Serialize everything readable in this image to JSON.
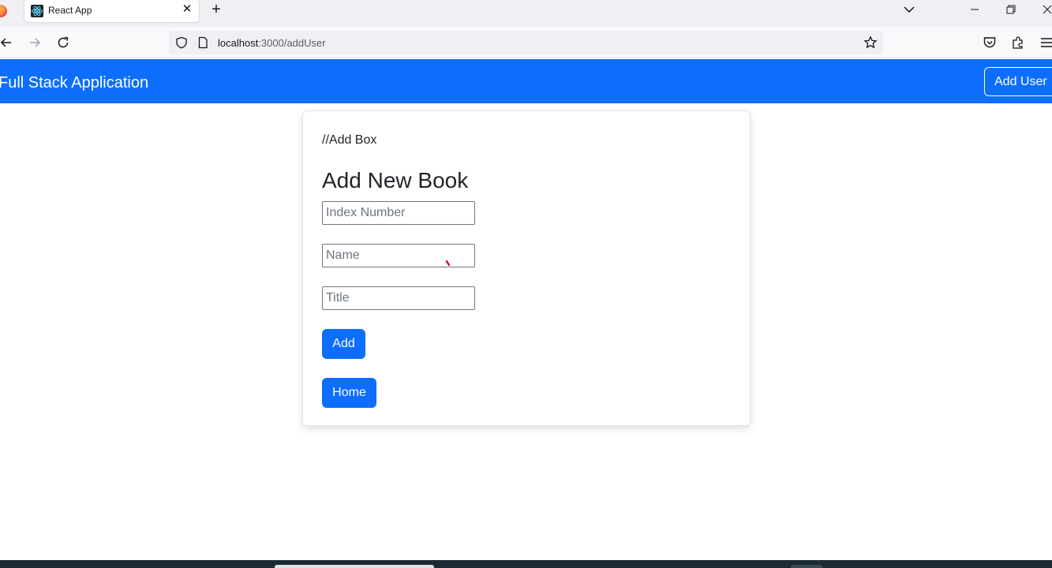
{
  "browser": {
    "tab": {
      "title": "React App"
    },
    "url": {
      "host": "localhost",
      "path": ":3000/addUser"
    }
  },
  "app": {
    "brand": "Full Stack Application",
    "add_user_label": "Add User",
    "comment": "//Add Box",
    "heading": "Add New Book",
    "fields": {
      "index_placeholder": "Index Number",
      "name_placeholder": "Name",
      "title_placeholder": "Title"
    },
    "add_label": "Add",
    "home_label": "Home"
  },
  "colors": {
    "primary": "#0d6efd",
    "tabbar": "#f0f0f4",
    "taskbar": "#1c2b33"
  }
}
